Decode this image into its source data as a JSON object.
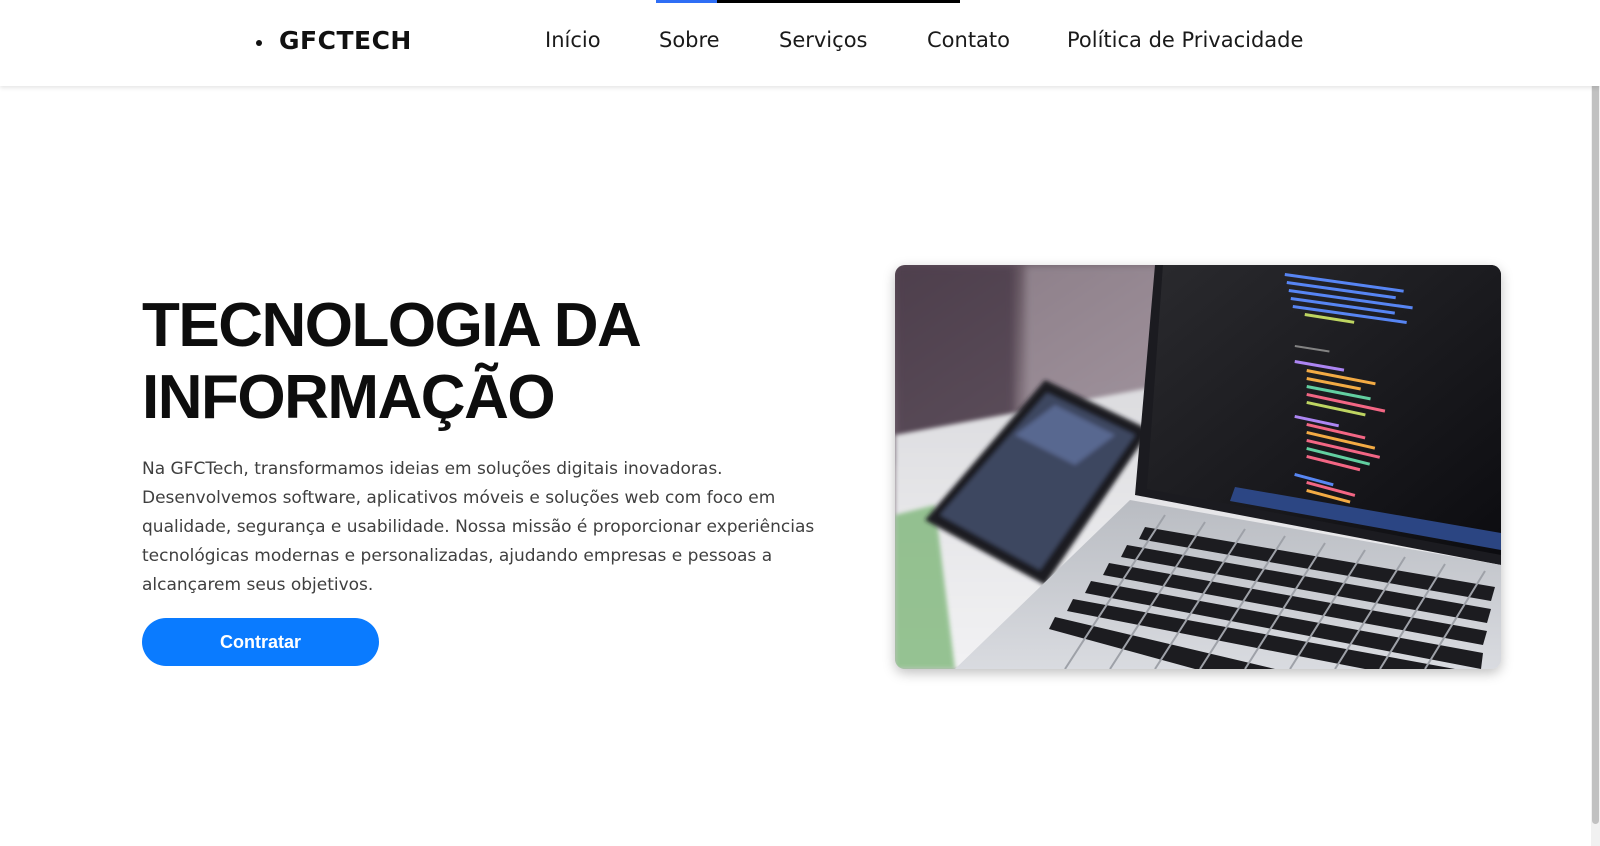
{
  "header": {
    "logo_text": "GFCTECH",
    "nav": [
      {
        "label": "Início"
      },
      {
        "label": "Sobre"
      },
      {
        "label": "Serviços"
      },
      {
        "label": "Contato"
      },
      {
        "label": "Política de Privacidade"
      }
    ]
  },
  "hero": {
    "title_line1": "TECNOLOGIA DA",
    "title_line2": "INFORMAÇÃO",
    "description": "Na GFCTech, transformamos ideias em soluções digitais inovadoras. Desenvolvemos software, aplicativos móveis e soluções web com foco em qualidade, segurança e usabilidade. Nossa missão é proporcionar experiências tecnológicas modernas e personalizadas, ajudando empresas e pessoas a alcançarem seus objetivos.",
    "cta_label": "Contratar",
    "image_subject": "laptop-with-code-and-smartphone"
  },
  "colors": {
    "accent": "#0a7bff",
    "nav_indicator": "#2f6ef5",
    "title": "#0d0d0d",
    "body_text": "#3f3f3f"
  }
}
